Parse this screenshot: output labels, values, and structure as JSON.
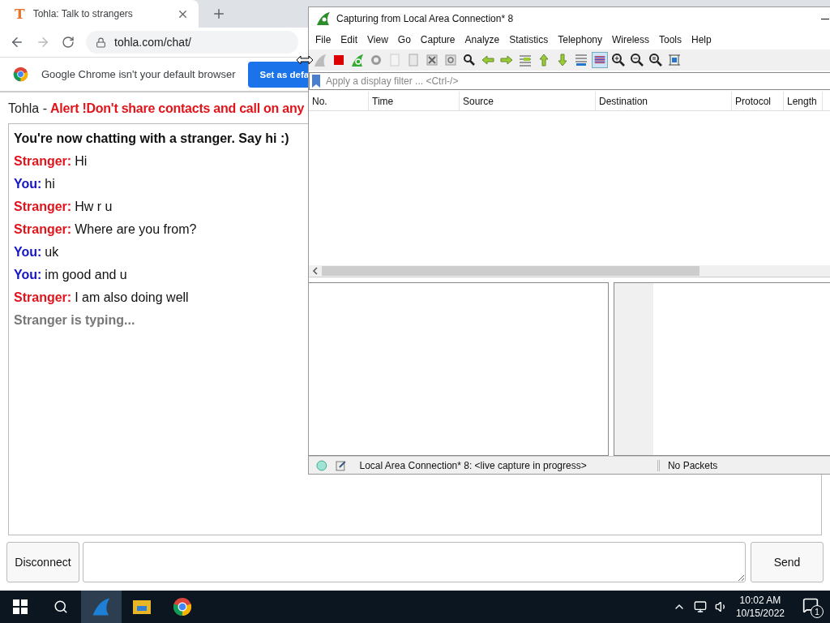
{
  "browser": {
    "tab": {
      "favicon": "T",
      "title": "Tohla: Talk to strangers",
      "selected": true
    },
    "url": "tohla.com/chat/",
    "infobar": {
      "text": "Google Chrome isn't your default browser",
      "button": "Set as defa"
    }
  },
  "page": {
    "site": "Tohla -",
    "alert": "Alert !Don't share contacts and call on any",
    "messages": [
      {
        "kind": "system",
        "text": "You're now chatting with a stranger. Say hi :)"
      },
      {
        "kind": "stranger",
        "speaker": "Stranger:",
        "text": "Hi"
      },
      {
        "kind": "you",
        "speaker": "You:",
        "text": "hi"
      },
      {
        "kind": "stranger",
        "speaker": "Stranger:",
        "text": "Hw r u"
      },
      {
        "kind": "stranger",
        "speaker": "Stranger:",
        "text": "Where are you from?"
      },
      {
        "kind": "you",
        "speaker": "You:",
        "text": "uk"
      },
      {
        "kind": "you",
        "speaker": "You:",
        "text": "im good and u"
      },
      {
        "kind": "stranger",
        "speaker": "Stranger:",
        "text": "I am also doing well"
      },
      {
        "kind": "typing",
        "text": "Stranger is typing..."
      }
    ],
    "disconnect": "Disconnect",
    "send": "Send"
  },
  "wireshark": {
    "title": "Capturing from Local Area Connection* 8",
    "menu": [
      "File",
      "Edit",
      "View",
      "Go",
      "Capture",
      "Analyze",
      "Statistics",
      "Telephony",
      "Wireless",
      "Tools",
      "Help"
    ],
    "filter": {
      "placeholder": "Apply a display filter ... <Ctrl-/>"
    },
    "columns": [
      "No.",
      "Time",
      "Source",
      "Destination",
      "Protocol",
      "Length"
    ],
    "status_bar": {
      "capture": "Local Area Connection* 8: <live capture in progress>",
      "packets": "No Packets"
    }
  },
  "taskbar": {
    "time": "10:02 AM",
    "date": "10/15/2022",
    "notifications": "1"
  }
}
